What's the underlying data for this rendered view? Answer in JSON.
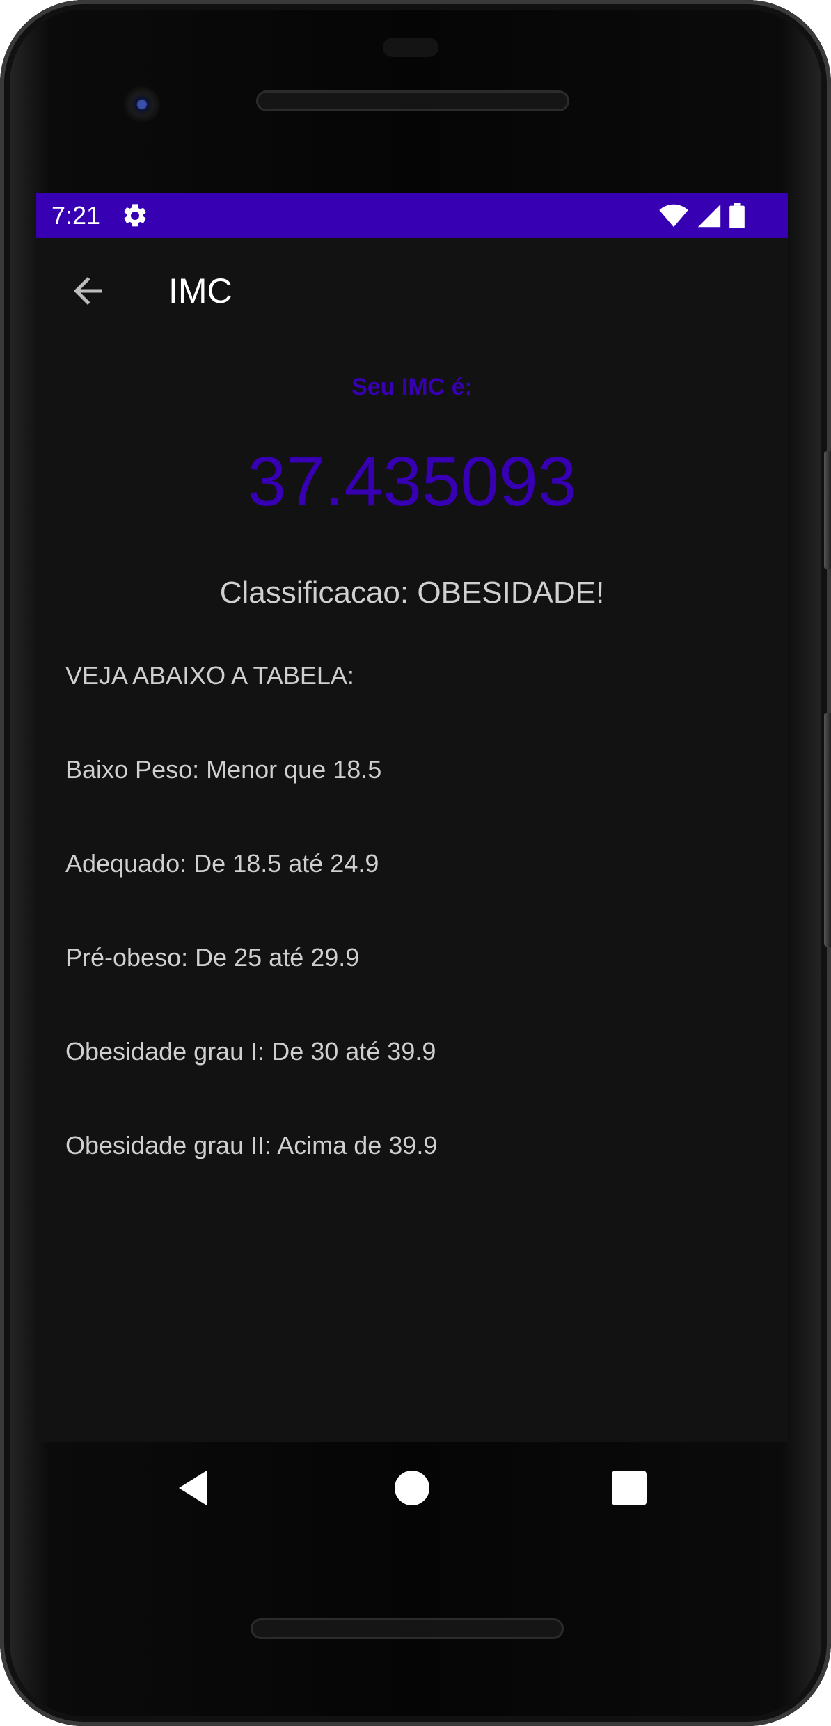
{
  "status_bar": {
    "time": "7:21",
    "color": "#3700b3",
    "icons": [
      "gear-icon",
      "wifi-icon",
      "signal-icon",
      "battery-icon"
    ]
  },
  "app_bar": {
    "title": "IMC",
    "back_icon": "back-arrow-icon"
  },
  "result": {
    "label": "Seu IMC é:",
    "value": "37.435093",
    "classification": "Classificacao: OBESIDADE!"
  },
  "table": {
    "heading": "VEJA ABAIXO A TABELA:",
    "rows": [
      "Baixo Peso: Menor que 18.5",
      "Adequado: De 18.5 até 24.9",
      "Pré-obeso: De 25 até 29.9",
      "Obesidade grau I: De 30 até 39.9",
      "Obesidade grau II: Acima de 39.9"
    ]
  },
  "nav_bar": {
    "icons": [
      "back-triangle-icon",
      "home-circle-icon",
      "recents-square-icon"
    ]
  },
  "colors": {
    "accent": "#3700b3",
    "background": "#121212",
    "text": "#cfcfcf"
  }
}
